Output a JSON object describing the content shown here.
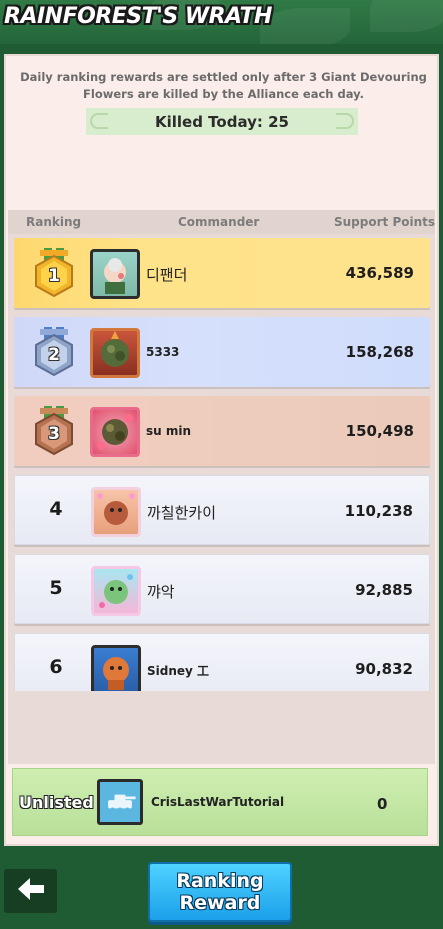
{
  "header": {
    "title": "RAINFOREST'S WRATH"
  },
  "notice": {
    "text": "Daily ranking rewards are settled only after 3 Giant Devouring Flowers are killed by the Alliance each day.",
    "killed_today": "Killed Today: 25"
  },
  "columns": {
    "ranking": "Ranking",
    "commander": "Commander",
    "support_points": "Support Points"
  },
  "rows": [
    {
      "rank": "1",
      "name": "디팬더",
      "points": "436,589",
      "tier": "gold"
    },
    {
      "rank": "2",
      "name": "5333",
      "points": "158,268",
      "tier": "silver"
    },
    {
      "rank": "3",
      "name": "su min",
      "points": "150,498",
      "tier": "bronze"
    },
    {
      "rank": "4",
      "name": "까칠한카이",
      "points": "110,238",
      "tier": "plain"
    },
    {
      "rank": "5",
      "name": "꺄악",
      "points": "92,885",
      "tier": "plain"
    },
    {
      "rank": "6",
      "name": "Sidney 工",
      "points": "90,832",
      "tier": "plain"
    }
  ],
  "self_row": {
    "label": "Unlisted",
    "name": "CrisLastWarTutorial",
    "points": "0"
  },
  "buttons": {
    "back_icon": "arrow-left-icon",
    "ranking_reward": "Ranking\nReward"
  },
  "colors": {
    "gold": "#ffe389",
    "silver": "#d6e0fc",
    "bronze": "#efcdbd",
    "self": "#c6e9a8",
    "button": "#1ba0ea"
  }
}
